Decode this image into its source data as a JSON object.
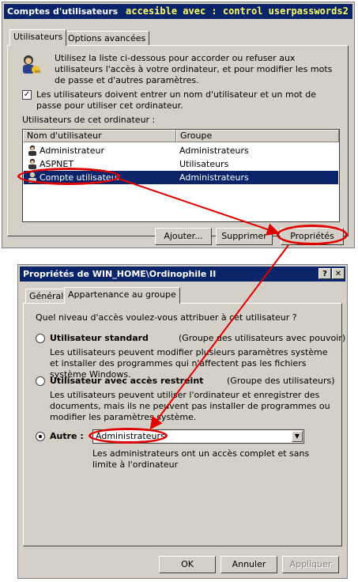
{
  "window1": {
    "title": "Comptes d'utilisateurs",
    "title_note": "accesible avec : control userpasswords2",
    "tabs": [
      {
        "label": "Utilisateurs",
        "active": true
      },
      {
        "label": "Options avancées",
        "active": false
      }
    ],
    "intro_text": "Utilisez la liste ci-dessous pour accorder ou refuser aux utilisateurs l'accès à votre ordinateur, et pour modifier les mots de passe et d'autres paramètres.",
    "checkbox": {
      "label": "Les utilisateurs doivent entrer un nom d'utilisateur et un mot de passe pour utiliser cet ordinateur.",
      "checked": true
    },
    "list_label": "Utilisateurs de cet ordinateur :",
    "columns": [
      "Nom d'utilisateur",
      "Groupe"
    ],
    "rows": [
      {
        "name": "Administrateur",
        "group": "Administrateurs",
        "selected": false
      },
      {
        "name": "ASPNET",
        "group": "Utilisateurs",
        "selected": false
      },
      {
        "name": "Compte utilisateur",
        "group": "Administrateurs",
        "selected": true
      }
    ],
    "buttons": {
      "add": "Ajouter...",
      "delete": "Supprimer",
      "properties": "Propriétés"
    }
  },
  "window2": {
    "title": "Propriétés de WIN_HOME\\Ordinophile II",
    "help_glyph": "?",
    "close_glyph": "✕",
    "tabs": [
      {
        "label": "Général",
        "active": false
      },
      {
        "label": "Appartenance au groupe",
        "active": true
      }
    ],
    "question": "Quel niveau d'accès voulez-vous attribuer à cet utilisateur ?",
    "options": [
      {
        "label": "Utilisateur standard",
        "group": "(Groupe des utilisateurs avec pouvoir)",
        "description": "Les utilisateurs peuvent modifier plusieurs paramètres système et installer des programmes qui n'affectent pas les fichiers système Windows.",
        "selected": false
      },
      {
        "label": "Utilisateur avec accès restreint",
        "group": "(Groupe des utilisateurs)",
        "description": "Les utilisateurs peuvent utiliser l'ordinateur et enregistrer des documents, mais ils ne peuvent pas installer de programmes ou modifier les paramètres système.",
        "selected": false
      },
      {
        "label": "Autre :",
        "selected": true
      }
    ],
    "other_select": {
      "value": "Administrateurs"
    },
    "other_description": "Les administrateurs ont un accès complet et sans limite à l'ordinateur",
    "buttons": {
      "ok": "OK",
      "cancel": "Annuler",
      "apply": "Appliquer"
    }
  },
  "annotation_color": "#e00000"
}
